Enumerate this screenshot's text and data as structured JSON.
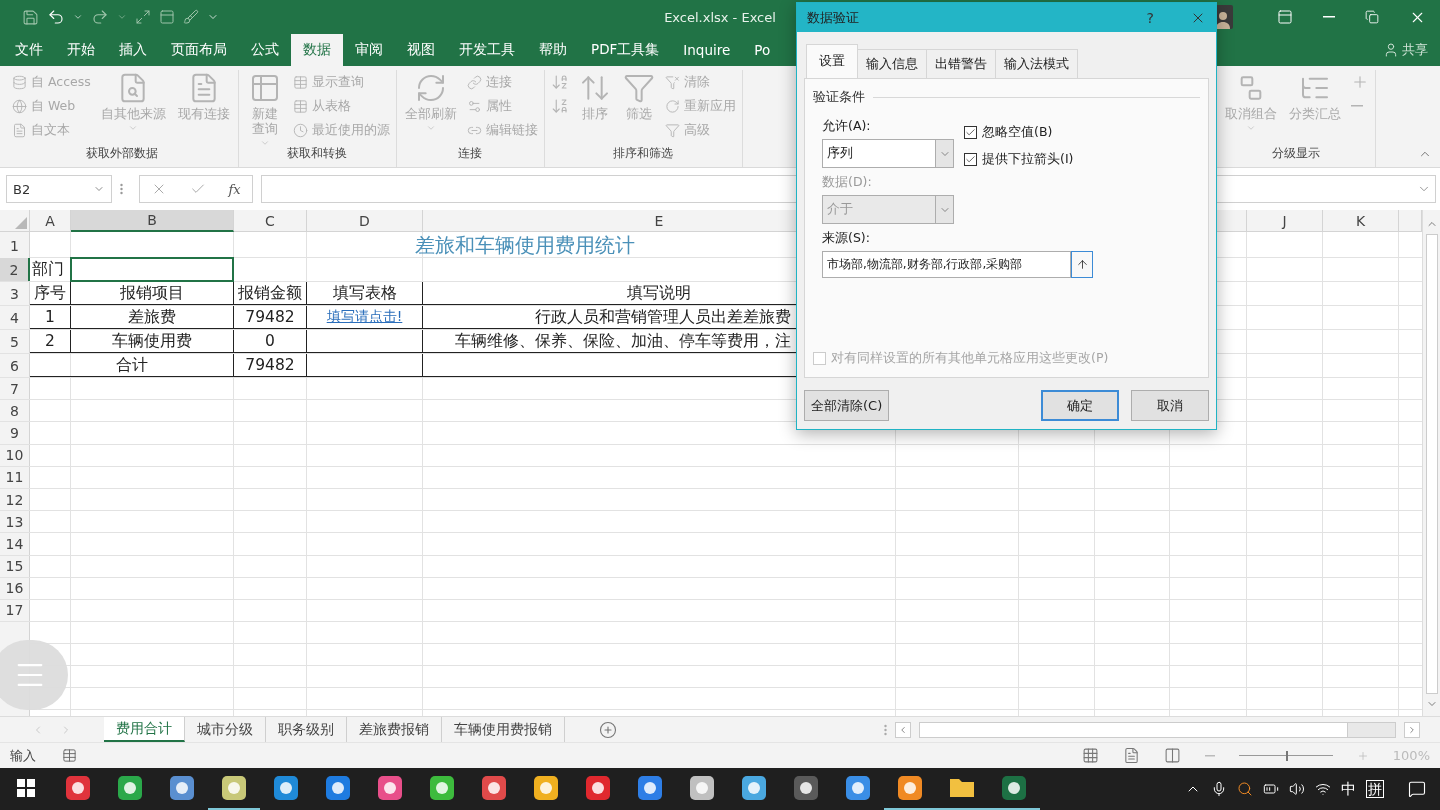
{
  "window": {
    "title": "Excel.xlsx  -  Excel",
    "share": "共享"
  },
  "menu_tabs": [
    {
      "label": "文件",
      "selected": false
    },
    {
      "label": "开始",
      "selected": false
    },
    {
      "label": "插入",
      "selected": false
    },
    {
      "label": "页面布局",
      "selected": false
    },
    {
      "label": "公式",
      "selected": false
    },
    {
      "label": "数据",
      "selected": true
    },
    {
      "label": "审阅",
      "selected": false
    },
    {
      "label": "视图",
      "selected": false
    },
    {
      "label": "开发工具",
      "selected": false
    },
    {
      "label": "帮助",
      "selected": false
    },
    {
      "label": "PDF工具集",
      "selected": false
    },
    {
      "label": "Inquire",
      "selected": false
    },
    {
      "label": "Po",
      "selected": false
    }
  ],
  "ribbon": {
    "groups": [
      {
        "label": "获取外部数据",
        "items": [
          {
            "kind": "stack",
            "entries": [
              "自 Access",
              "自 Web",
              "自文本"
            ]
          },
          {
            "kind": "large",
            "label": "自其他来源",
            "menu": true
          },
          {
            "kind": "large",
            "label": "现有连接",
            "menu": false
          }
        ]
      },
      {
        "label": "获取和转换",
        "items": [
          {
            "kind": "split",
            "label": "新建查询",
            "menu": true
          },
          {
            "kind": "stack",
            "entries": [
              "显示查询",
              "从表格",
              "最近使用的源"
            ]
          }
        ]
      },
      {
        "label": "连接",
        "items": [
          {
            "kind": "large",
            "label": "全部刷新",
            "menu": true
          },
          {
            "kind": "stack",
            "entries": [
              "连接",
              "属性",
              "编辑链接"
            ]
          }
        ]
      },
      {
        "label": "排序和筛选",
        "items": [
          {
            "kind": "pair"
          },
          {
            "kind": "large",
            "label": "排序",
            "menu": false
          },
          {
            "kind": "large",
            "label": "筛选",
            "menu": false
          },
          {
            "kind": "stack",
            "entries": [
              "清除",
              "重新应用",
              "高级"
            ]
          }
        ]
      },
      {
        "label": "分级显示",
        "items": [
          {
            "kind": "large",
            "label": "取消组合",
            "menu": true
          },
          {
            "kind": "large",
            "label": "分类汇总",
            "menu": false
          },
          {
            "kind": "pair"
          }
        ]
      }
    ]
  },
  "formula_bar": {
    "name_box": "B2",
    "function_button": "fx"
  },
  "sheet": {
    "columns": [
      {
        "kind": "header",
        "label": "A",
        "selected": false
      },
      {
        "kind": "header",
        "label": "B",
        "selected": true
      },
      {
        "kind": "header",
        "label": "C",
        "selected": false
      },
      {
        "kind": "header",
        "label": "D",
        "selected": false
      },
      {
        "kind": "header",
        "label": "E",
        "selected": false
      },
      {
        "kind": "covered"
      },
      {
        "kind": "covered"
      },
      {
        "kind": "covered"
      },
      {
        "kind": "partial"
      },
      {
        "kind": "header",
        "label": "J",
        "selected": false
      },
      {
        "kind": "header",
        "label": "K",
        "selected": false
      }
    ],
    "rows": [
      {
        "number": "1",
        "selected": false,
        "cells": [
          {
            "text": "差旅和车辆使用费用统计",
            "kind": "title"
          },
          {
            "merge": true
          },
          {
            "merge": true
          },
          {
            "merge": true
          },
          {
            "merge": true
          },
          {
            "merge": true
          },
          {
            "kind": "empty"
          },
          {
            "kind": "empty"
          },
          {
            "kind": "empty"
          },
          {
            "kind": "empty"
          },
          {
            "kind": "empty"
          }
        ]
      },
      {
        "number": "2",
        "selected": true,
        "cells": [
          {
            "text": "部门",
            "kind": "label"
          },
          {
            "kind": "empty",
            "selected": true
          },
          {
            "kind": "empty"
          },
          {
            "kind": "empty"
          },
          {
            "kind": "empty"
          },
          {
            "kind": "empty"
          },
          {
            "kind": "empty"
          },
          {
            "kind": "empty"
          },
          {
            "kind": "empty"
          },
          {
            "kind": "empty"
          },
          {
            "kind": "empty"
          }
        ]
      },
      {
        "number": "3",
        "selected": false,
        "bordered": true,
        "cells": [
          {
            "text": "序号",
            "kind": "center"
          },
          {
            "text": "报销项目",
            "kind": "center"
          },
          {
            "text": "报销金额",
            "kind": "center"
          },
          {
            "text": "填写表格",
            "kind": "center"
          },
          {
            "text": "填写说明",
            "kind": "center"
          },
          {
            "kind": "empty"
          },
          {
            "kind": "empty"
          },
          {
            "kind": "empty"
          },
          {
            "kind": "empty"
          },
          {
            "kind": "empty"
          },
          {
            "kind": "empty"
          }
        ]
      },
      {
        "number": "4",
        "selected": false,
        "bordered": true,
        "cells": [
          {
            "text": "1",
            "kind": "center"
          },
          {
            "text": "差旅费",
            "kind": "center"
          },
          {
            "text": "79482",
            "kind": "center"
          },
          {
            "text": "填写请点击!",
            "kind": "link"
          },
          {
            "text": "行政人员和营销管理人员出差差旅费",
            "kind": "cut"
          },
          {
            "kind": "empty"
          },
          {
            "kind": "empty"
          },
          {
            "kind": "empty"
          },
          {
            "kind": "empty"
          },
          {
            "kind": "empty"
          },
          {
            "kind": "empty"
          }
        ]
      },
      {
        "number": "5",
        "selected": false,
        "bordered": true,
        "cells": [
          {
            "text": "2",
            "kind": "center"
          },
          {
            "text": "车辆使用费",
            "kind": "center"
          },
          {
            "text": "0",
            "kind": "center"
          },
          {
            "kind": "empty"
          },
          {
            "text": "车辆维修、保养、保险、加油、停车等费用，注",
            "kind": "cut"
          },
          {
            "kind": "empty"
          },
          {
            "kind": "empty"
          },
          {
            "kind": "empty"
          },
          {
            "kind": "empty"
          },
          {
            "kind": "empty"
          },
          {
            "kind": "empty"
          }
        ]
      },
      {
        "number": "6",
        "selected": false,
        "bordered": true,
        "cells": [
          {
            "text": "合计",
            "kind": "center"
          },
          {
            "merge": true
          },
          {
            "text": "79482",
            "kind": "center"
          },
          {
            "kind": "empty"
          },
          {
            "kind": "empty"
          },
          {
            "kind": "empty"
          },
          {
            "kind": "empty"
          },
          {
            "kind": "empty"
          },
          {
            "kind": "empty"
          },
          {
            "kind": "empty"
          },
          {
            "kind": "empty"
          }
        ]
      },
      {
        "number": "7",
        "selected": false
      },
      {
        "number": "8",
        "selected": false
      },
      {
        "number": "9",
        "selected": false
      },
      {
        "number": "10",
        "selected": false
      },
      {
        "number": "11",
        "selected": false
      },
      {
        "number": "12",
        "selected": false
      },
      {
        "number": "13",
        "selected": false
      },
      {
        "number": "14",
        "selected": false
      },
      {
        "number": "15",
        "selected": false
      },
      {
        "number": "16",
        "selected": false
      },
      {
        "number": "17",
        "selected": false
      }
    ]
  },
  "sheet_tabs": [
    {
      "label": "费用合计",
      "selected": true
    },
    {
      "label": "城市分级",
      "selected": false
    },
    {
      "label": "职务级别",
      "selected": false
    },
    {
      "label": "差旅费报销",
      "selected": false
    },
    {
      "label": "车辆使用费报销",
      "selected": false
    }
  ],
  "status_bar": {
    "mode": "输入",
    "zoom": {
      "reading": "100%",
      "level": 0.5
    }
  },
  "dialog": {
    "title": "数据验证",
    "help": "?",
    "tabs": [
      {
        "label": "设置",
        "selected": true
      },
      {
        "label": "输入信息",
        "selected": false
      },
      {
        "label": "出错警告",
        "selected": false
      },
      {
        "label": "输入法模式",
        "selected": false
      }
    ],
    "section": "验证条件",
    "allow": {
      "label": "允许(A):",
      "value": "序列"
    },
    "ignore_blank": {
      "label": "忽略空值(B)",
      "checked": true
    },
    "dropdown": {
      "label": "提供下拉箭头(I)",
      "checked": true
    },
    "data": {
      "label": "数据(D):",
      "value": "介于",
      "disabled": true
    },
    "source": {
      "label": "来源(S):",
      "value": "市场部,物流部,财务部,行政部,采购部"
    },
    "apply_all": {
      "label": "对有同样设置的所有其他单元格应用这些更改(P)",
      "checked": false,
      "disabled": true
    },
    "buttons": [
      {
        "label": "全部清除(C)",
        "kind": "left"
      },
      {
        "label": "确定",
        "kind": "default"
      },
      {
        "label": "取消",
        "kind": "normal"
      }
    ]
  },
  "taskbar": {
    "items": [
      {
        "kind": "start",
        "running": false
      },
      {
        "kind": "app",
        "color": "#e0333c",
        "running": false
      },
      {
        "kind": "app",
        "color": "#2aa84a",
        "running": false
      },
      {
        "kind": "app",
        "color": "#5a8fd0",
        "running": false
      },
      {
        "kind": "app",
        "color": "#c8c878",
        "running": true
      },
      {
        "kind": "app",
        "color": "#1f8ad8",
        "running": false
      },
      {
        "kind": "app",
        "color": "#1e7be0",
        "running": false
      },
      {
        "kind": "app",
        "color": "#e84f8a",
        "running": false
      },
      {
        "kind": "app",
        "color": "#3dbb3d",
        "running": false
      },
      {
        "kind": "app",
        "color": "#e04a4a",
        "running": false
      },
      {
        "kind": "app",
        "color": "#f0b020",
        "running": false
      },
      {
        "kind": "app",
        "color": "#e0282e",
        "running": false
      },
      {
        "kind": "app",
        "color": "#2e7ee6",
        "running": false
      },
      {
        "kind": "app",
        "color": "#c0c0c0",
        "running": false
      },
      {
        "kind": "app",
        "color": "#4aa8e0",
        "running": false
      },
      {
        "kind": "app",
        "color": "#5a5a5a",
        "running": false
      },
      {
        "kind": "app",
        "color": "#3a8ee6",
        "running": false
      },
      {
        "kind": "app",
        "color": "#f08a24",
        "running": true
      },
      {
        "kind": "folder",
        "color": "#f2c040",
        "running": true
      },
      {
        "kind": "app",
        "color": "#1d7044",
        "running": true
      }
    ],
    "ime_mode": "中",
    "ime": "拼"
  }
}
